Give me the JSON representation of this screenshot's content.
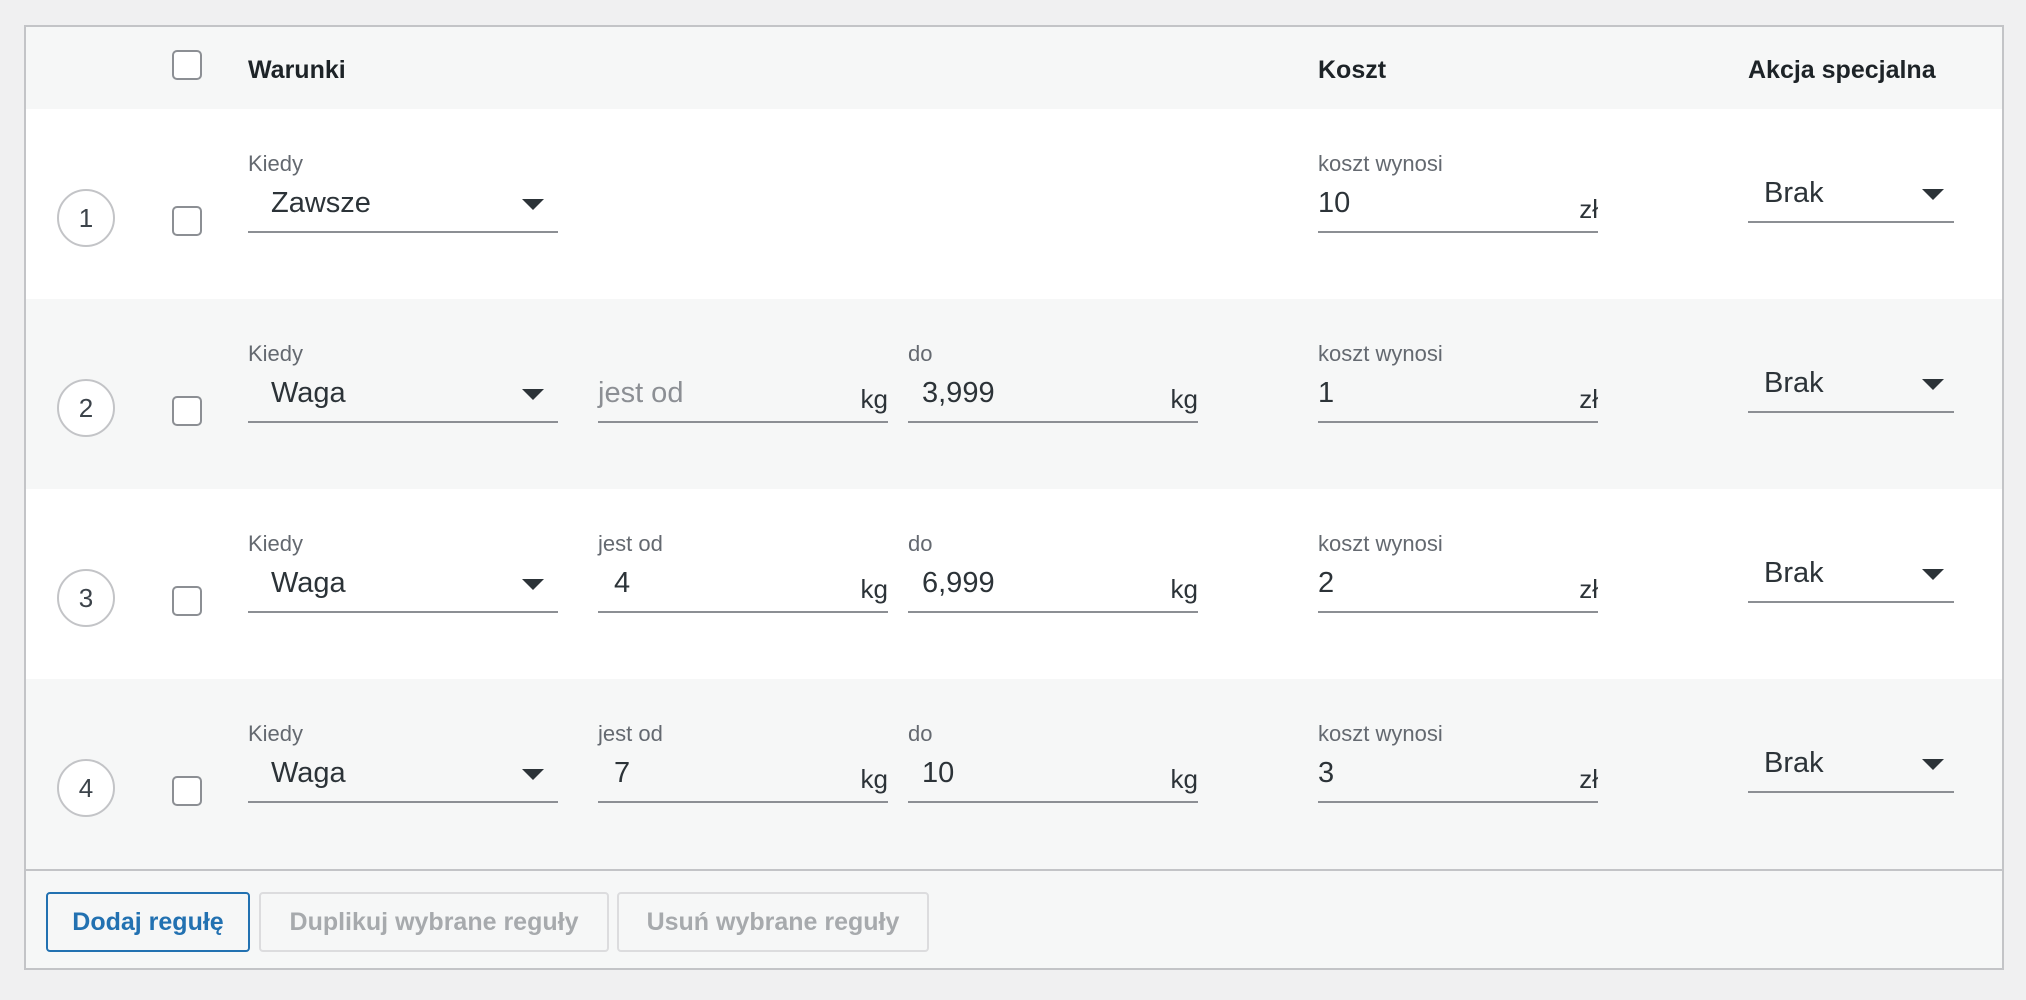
{
  "header": {
    "conditions": "Warunki",
    "cost": "Koszt",
    "special_action": "Akcja specjalna"
  },
  "rows": [
    {
      "number": "1",
      "when_label": "Kiedy",
      "when_value": "Zawsze",
      "cost_label": "koszt wynosi",
      "cost_value": "10",
      "cost_unit": "zł",
      "action_value": "Brak"
    },
    {
      "number": "2",
      "when_label": "Kiedy",
      "when_value": "Waga",
      "from_placeholder": "jest od",
      "from_unit": "kg",
      "to_label": "do",
      "to_value": "3,999",
      "to_unit": "kg",
      "cost_label": "koszt wynosi",
      "cost_value": "1",
      "cost_unit": "zł",
      "action_value": "Brak"
    },
    {
      "number": "3",
      "when_label": "Kiedy",
      "when_value": "Waga",
      "from_label": "jest od",
      "from_value": "4",
      "from_unit": "kg",
      "to_label": "do",
      "to_value": "6,999",
      "to_unit": "kg",
      "cost_label": "koszt wynosi",
      "cost_value": "2",
      "cost_unit": "zł",
      "action_value": "Brak"
    },
    {
      "number": "4",
      "when_label": "Kiedy",
      "when_value": "Waga",
      "from_label": "jest od",
      "from_value": "7",
      "from_unit": "kg",
      "to_label": "do",
      "to_value": "10",
      "to_unit": "kg",
      "cost_label": "koszt wynosi",
      "cost_value": "3",
      "cost_unit": "zł",
      "action_value": "Brak"
    }
  ],
  "footer": {
    "add_rule": "Dodaj regułę",
    "duplicate_selected": "Duplikuj wybrane reguły",
    "delete_selected": "Usuń wybrane reguły"
  },
  "colors": {
    "primary": "#2271b1",
    "disabled_text": "#a7aaad",
    "border": "#c3c4c7"
  }
}
